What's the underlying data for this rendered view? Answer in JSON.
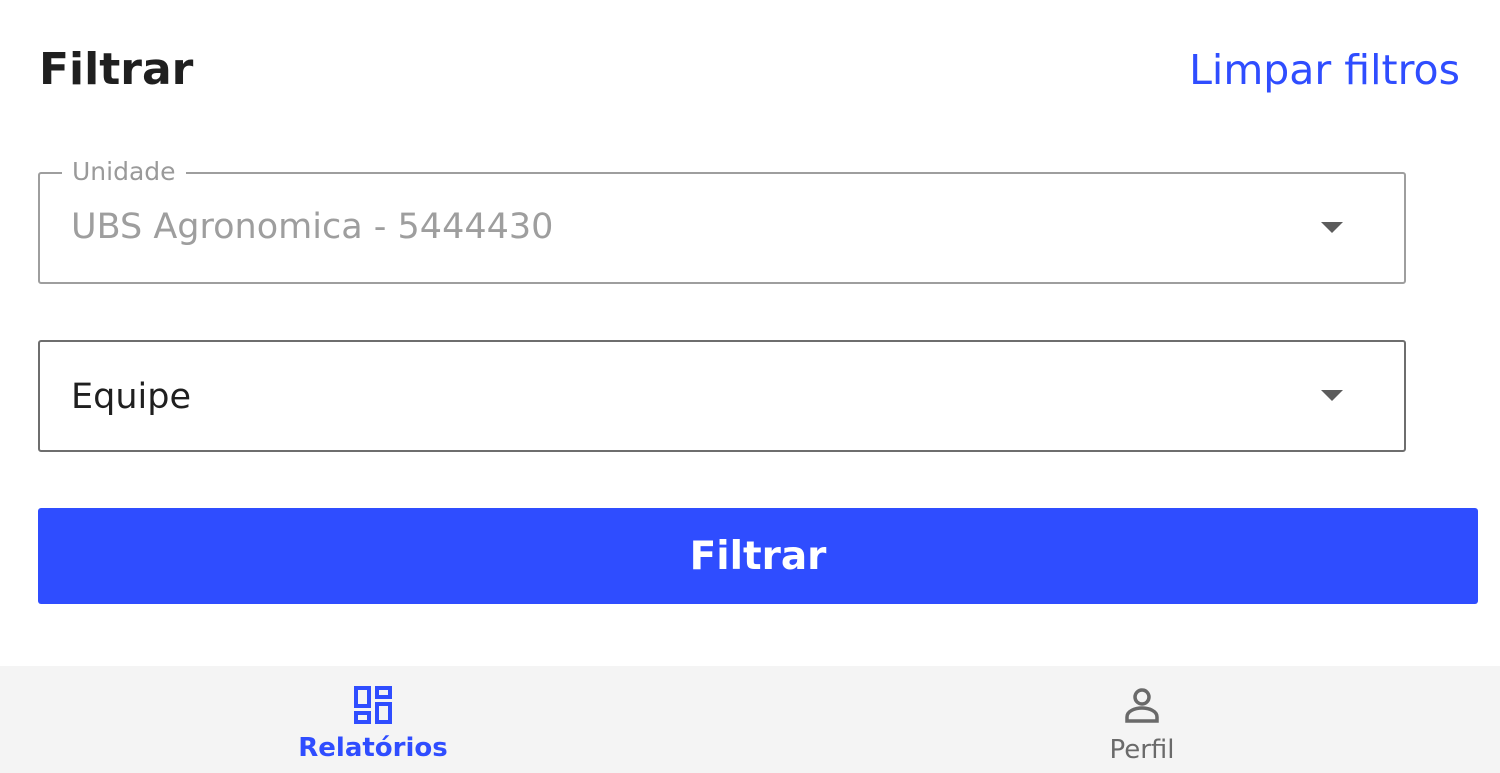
{
  "header": {
    "title": "Filtrar",
    "clear_link": "Limpar filtros"
  },
  "filters": {
    "unidade": {
      "label": "Unidade",
      "value": "UBS Agronomica - 5444430"
    },
    "equipe": {
      "value": "Equipe"
    }
  },
  "submit_label": "Filtrar",
  "bottom_nav": {
    "items": [
      {
        "label": "Relatórios",
        "icon": "dashboard-icon",
        "active": true
      },
      {
        "label": "Perfil",
        "icon": "person-icon",
        "active": false
      }
    ]
  },
  "colors": {
    "accent": "#2f4dff",
    "text": "#1f1f1f",
    "muted": "#9e9e9e",
    "nav_background": "#f4f4f4"
  }
}
